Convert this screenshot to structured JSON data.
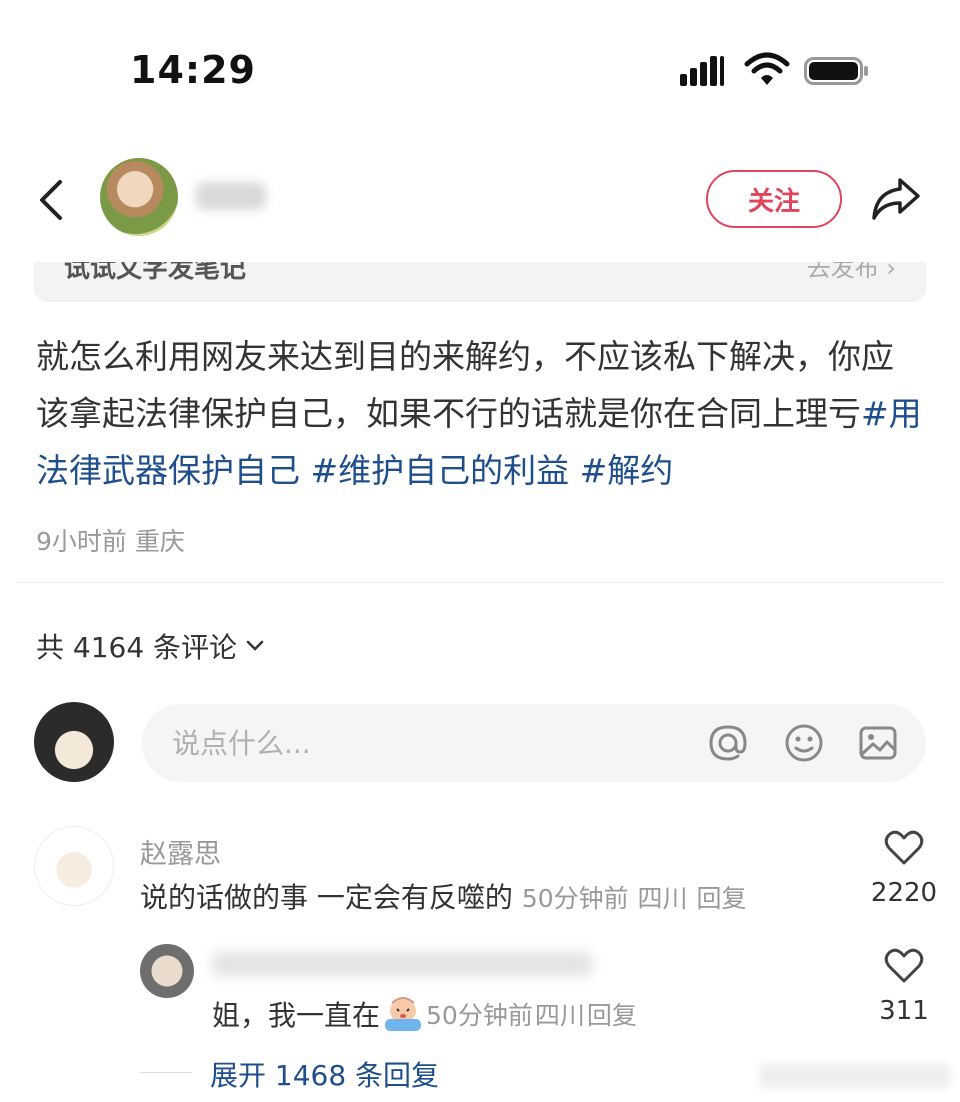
{
  "status_bar": {
    "time": "14:29"
  },
  "header": {
    "follow_label": "关注"
  },
  "note_strip": {
    "text": "试试文字发笔记",
    "publish": "去发布 ›"
  },
  "post": {
    "text_plain": "就怎么利用网友来达到目的来解约，不应该私下解决，你应该拿起法律保护自己，如果不行的话就是你在合同上理亏",
    "hashtags": [
      "#用法律武器保护自己",
      "#维护自己的利益",
      "#解约"
    ],
    "time": "9小时前",
    "location": "重庆"
  },
  "comments_header": {
    "count_label": "共 4164 条评论"
  },
  "comment_input": {
    "placeholder": "说点什么..."
  },
  "comments": [
    {
      "author": "赵露思",
      "text": "说的话做的事 一定会有反噬的",
      "time": "50分钟前",
      "location": "四川",
      "reply_label": "回复",
      "likes": "2220",
      "replies": [
        {
          "text": "姐，我一直在",
          "time": "50分钟前",
          "location": "四川",
          "reply_label": "回复",
          "likes": "311"
        }
      ],
      "expand_label": "展开 1468 条回复"
    }
  ],
  "colors": {
    "accent_red": "#e0455c",
    "link_blue": "#1f4e8c"
  }
}
